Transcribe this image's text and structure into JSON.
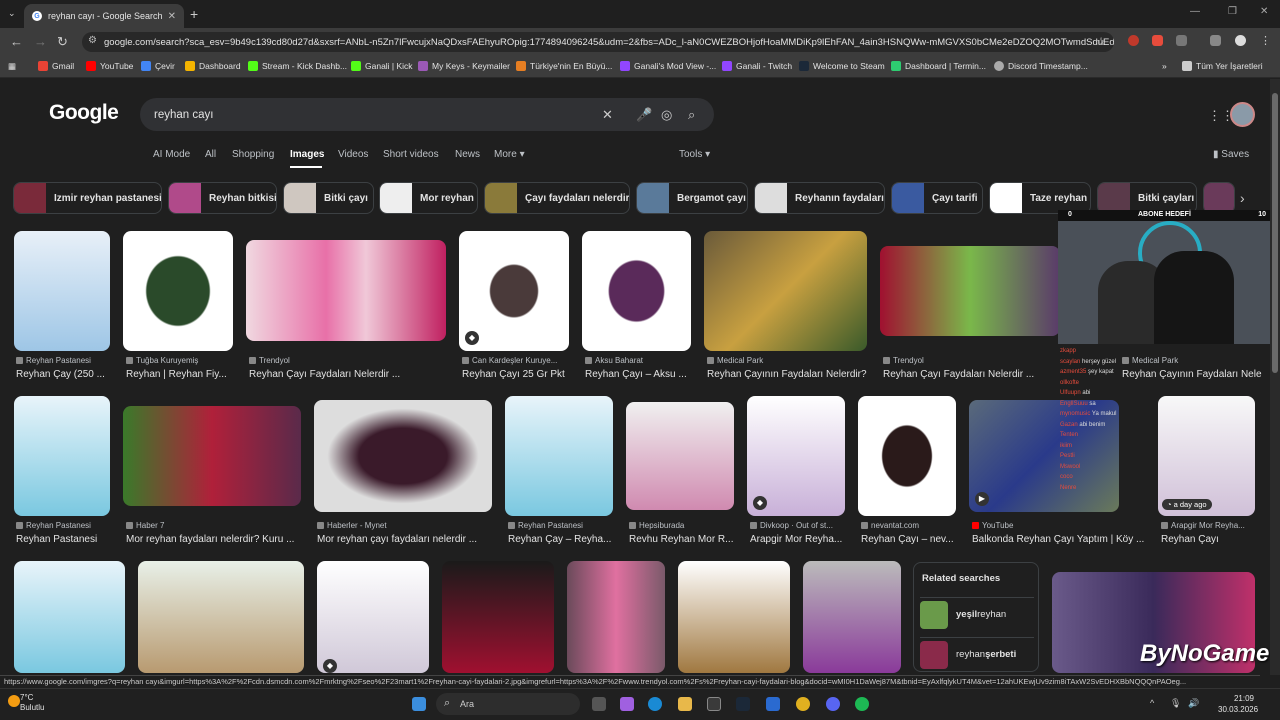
{
  "browser": {
    "tab_title": "reyhan cayı - Google Search",
    "url": "google.com/search?sca_esv=9b49c139cd80d27d&sxsrf=ANbL-n5Zn7lFwcujxNaQDxsFAEhyuROpig:1774894096245&udm=2&fbs=ADc_l-aN0CWEZBOHjofHoaMMDiKp9lEhFAN_4ain3HSNQWw-mMGVXS0bCMe2eDZOQ2MOTwmdSduEdP...",
    "bookmarks": [
      "Gmail",
      "YouTube",
      "Çevir",
      "Dashboard",
      "Stream - Kick Dashb...",
      "Ganali | Kick",
      "My Keys - Keymailer",
      "Türkiye'nin En Büyü...",
      "Ganali's Mod View -...",
      "Ganali - Twitch",
      "Welcome to Steam",
      "Dashboard | Termin...",
      "Discord Timestamp..."
    ],
    "all_bookmarks": "Tüm Yer İşaretleri"
  },
  "google": {
    "logo": "Google",
    "query": "reyhan cayı",
    "tabs": [
      "AI Mode",
      "All",
      "Shopping",
      "Images",
      "Videos",
      "Short videos",
      "News",
      "More"
    ],
    "active_tab": "Images",
    "tools": "Tools",
    "saves": "Saves",
    "chips": [
      "Izmir reyhan pastanesi",
      "Reyhan bitkisi",
      "Bitki çayı",
      "Mor reyhan",
      "Çayı faydaları nelerdir",
      "Bergamot çayı",
      "Reyhanın faydaları",
      "Çayı tarifi",
      "Taze reyhan",
      "Bitki çayları"
    ]
  },
  "results": {
    "row1": [
      {
        "source": "Reyhan Pastanesi",
        "caption": "Reyhan Çay (250 ..."
      },
      {
        "source": "Tuğba Kuruyemiş",
        "caption": "Reyhan | Reyhan Fiy..."
      },
      {
        "source": "Trendyol",
        "caption": "Reyhan Çayı Faydaları Nelerdir ..."
      },
      {
        "source": "Can Kardeşler Kuruye...",
        "caption": "Reyhan Çayı 25 Gr Pkt"
      },
      {
        "source": "Aksu Baharat",
        "caption": "Reyhan Çayı – Aksu ..."
      },
      {
        "source": "Medical Park",
        "caption": "Reyhan Çayının Faydaları Nelerdir?"
      },
      {
        "source": "Trendyol",
        "caption": "Reyhan Çayı Faydaları Nelerdir ..."
      },
      {
        "source": "Medical Park",
        "caption": "Reyhan Çayının Faydaları Nelerdir?"
      }
    ],
    "row2": [
      {
        "source": "Reyhan Pastanesi",
        "caption": "Reyhan Pastanesi"
      },
      {
        "source": "Haber 7",
        "caption": "Mor reyhan faydaları nelerdir? Kuru ..."
      },
      {
        "source": "Haberler - Mynet",
        "caption": "Mor reyhan çayı faydaları nelerdir ..."
      },
      {
        "source": "Reyhan Pastanesi",
        "caption": "Reyhan Çay – Reyha..."
      },
      {
        "source": "Hepsiburada",
        "caption": "Revhu Reyhan Mor R..."
      },
      {
        "source": "Divkoop · Out of st...",
        "caption": "Arapgir Mor Reyha..."
      },
      {
        "source": "nevantat.com",
        "caption": "Reyhan Çayı – nev..."
      },
      {
        "source": "YouTube",
        "caption": "Balkonda Reyhan Çayı Yaptım | Köy ..."
      },
      {
        "source": "Arapgir Mor Reyha...",
        "caption": "Reyhan Çayı"
      }
    ],
    "badge": "a day ago"
  },
  "related": {
    "title": "Related searches",
    "items": [
      {
        "bold": "yeşil",
        "rest": " reyhan"
      },
      {
        "bold": "",
        "rest": "reyhan ",
        "bold2": "şerbeti"
      }
    ]
  },
  "stream": {
    "goal_left": "0",
    "goal_title": "ABONE HEDEFİ",
    "goal_right": "10",
    "brand": "ByNoGame",
    "chat": [
      {
        "user": "zkapp",
        "msg": ""
      },
      {
        "user": "scaylan",
        "msg": "herşey güzel"
      },
      {
        "user": "azment35",
        "msg": "şey kapat"
      },
      {
        "user": "ollkofte",
        "msg": ""
      },
      {
        "user": "Ulfuupn",
        "msg": "abi"
      },
      {
        "user": "EnglISuuu",
        "msg": "sa"
      },
      {
        "user": "mynomusic",
        "msg": "Ya makul"
      },
      {
        "user": "Gazan",
        "msg": "abi benim"
      },
      {
        "user": "Tenten",
        "msg": ""
      },
      {
        "user": "ikiim",
        "msg": ""
      },
      {
        "user": "Pestli",
        "msg": ""
      },
      {
        "user": "Mswool",
        "msg": ""
      },
      {
        "user": "coco",
        "msg": ""
      },
      {
        "user": "Nenre",
        "msg": ""
      }
    ]
  },
  "status_url": "https://www.google.com/imgres?q=reyhan cayı&imgurl=https%3A%2F%2Fcdn.dsmcdn.com%2Fmrktng%2Fseo%2F23mart1%2Freyhan-cayi-faydalari-2.jpg&imgrefurl=https%3A%2F%2Fwww.trendyol.com%2Fs%2Freyhan-cayi-faydalari-blog&docid=wMI0H1DaWej87M&tbnid=EyAxlfqlykUT4M&vet=12ahUKEwjUv9zim8iTAxW2SvEDHXBbNQQQnPAOeg...",
  "taskbar": {
    "temp": "7°C",
    "weather": "Bulutlu",
    "search_placeholder": "Ara",
    "time": "21:09",
    "date": "30.03.2026"
  }
}
